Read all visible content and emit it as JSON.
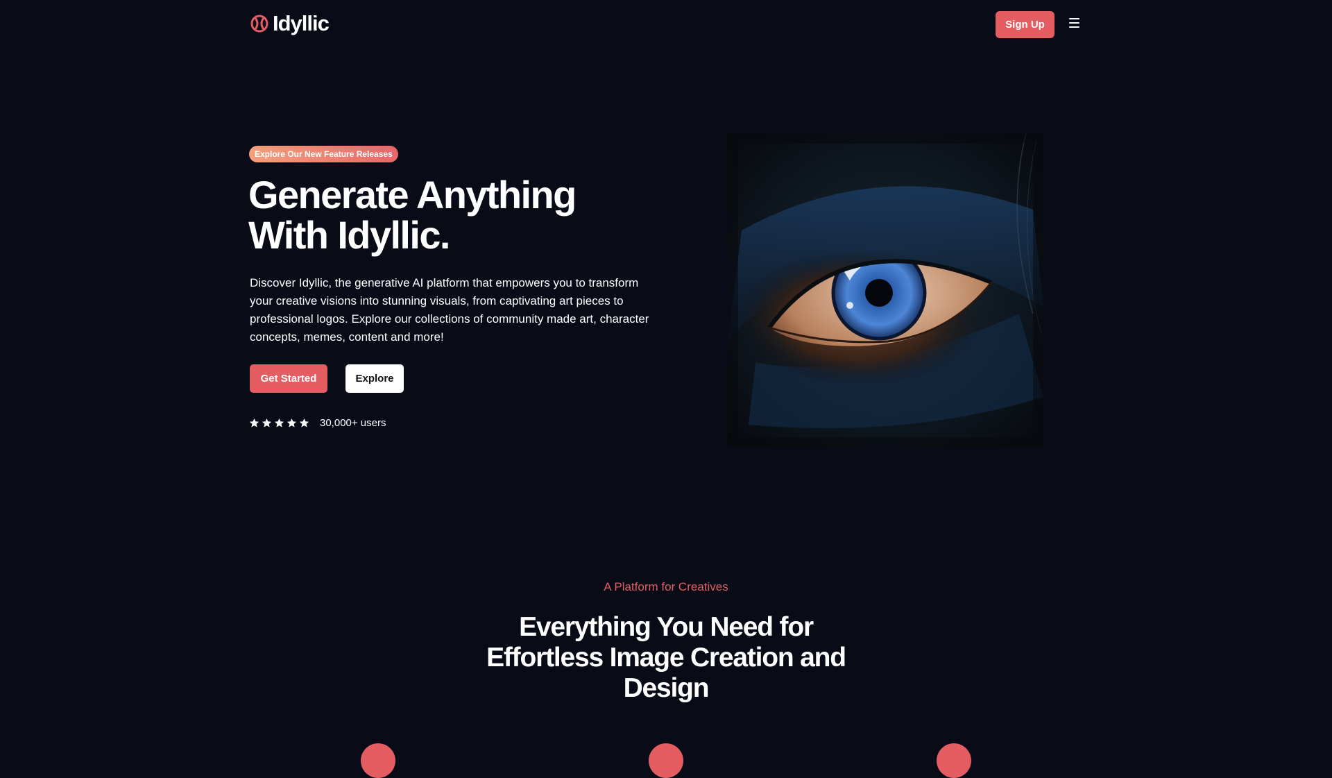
{
  "header": {
    "logo_text": "Idyllic",
    "signup_label": "Sign Up",
    "menu_icon": "hamburger-menu-icon"
  },
  "hero": {
    "badge": "Explore Our New Feature Releases",
    "title_line1": "Generate Anything",
    "title_line2": "With Idyllic.",
    "description": "Discover Idyllic, the generative AI platform that empowers you to transform your creative visions into stunning visuals, from captivating art pieces to professional logos. Explore our collections of community made art, character concepts, memes, content and more!",
    "primary_cta": "Get Started",
    "secondary_cta": "Explore",
    "rating_stars": 5,
    "users_text": "30,000+ users"
  },
  "platform_section": {
    "eyebrow": "A Platform for Creatives",
    "title": "Everything You Need for Effortless Image Creation and Design"
  },
  "colors": {
    "background": "#090b17",
    "accent": "#e35d62",
    "badge_gradient_start": "#f2a07c",
    "badge_gradient_end": "#e8666b",
    "text": "#ffffff"
  }
}
